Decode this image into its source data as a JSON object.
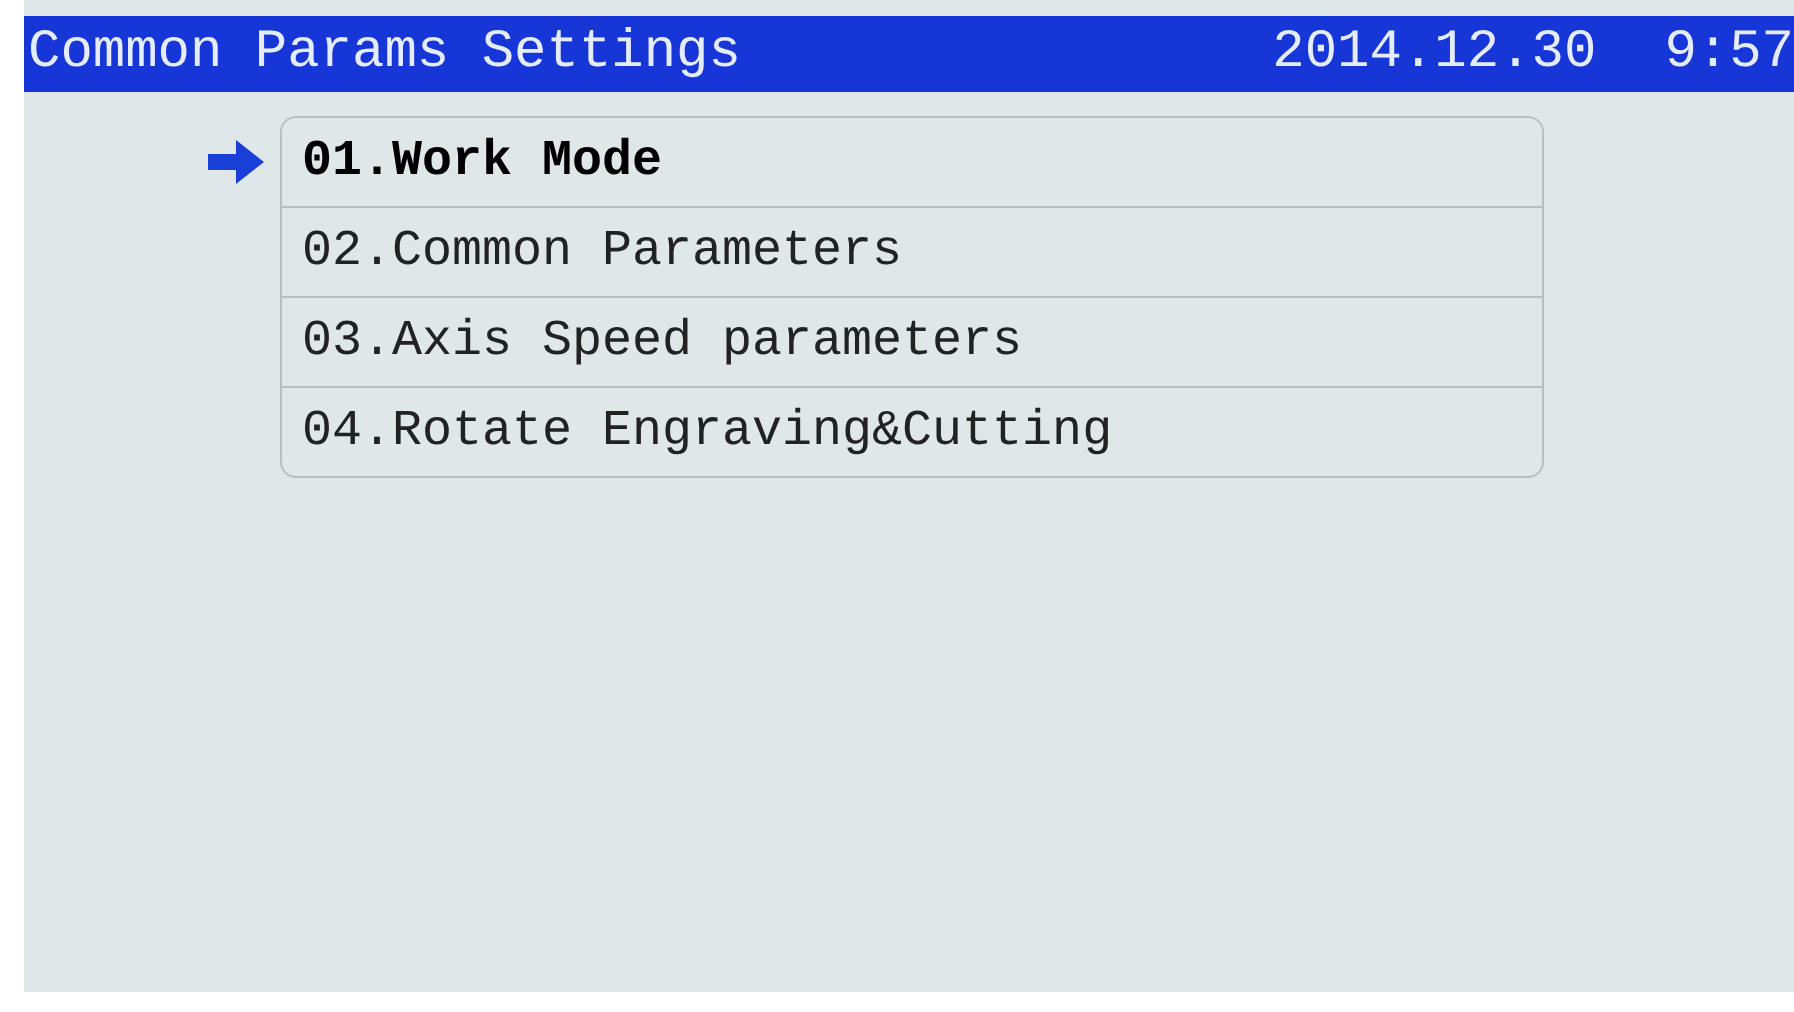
{
  "header": {
    "title": "Common Params Settings",
    "date": "2014.12.30",
    "time": "9:57"
  },
  "menu": [
    {
      "label": "01.Work Mode",
      "selected": true
    },
    {
      "label": "02.Common Parameters",
      "selected": false
    },
    {
      "label": "03.Axis Speed parameters",
      "selected": false
    },
    {
      "label": "04.Rotate Engraving&Cutting",
      "selected": false
    }
  ]
}
